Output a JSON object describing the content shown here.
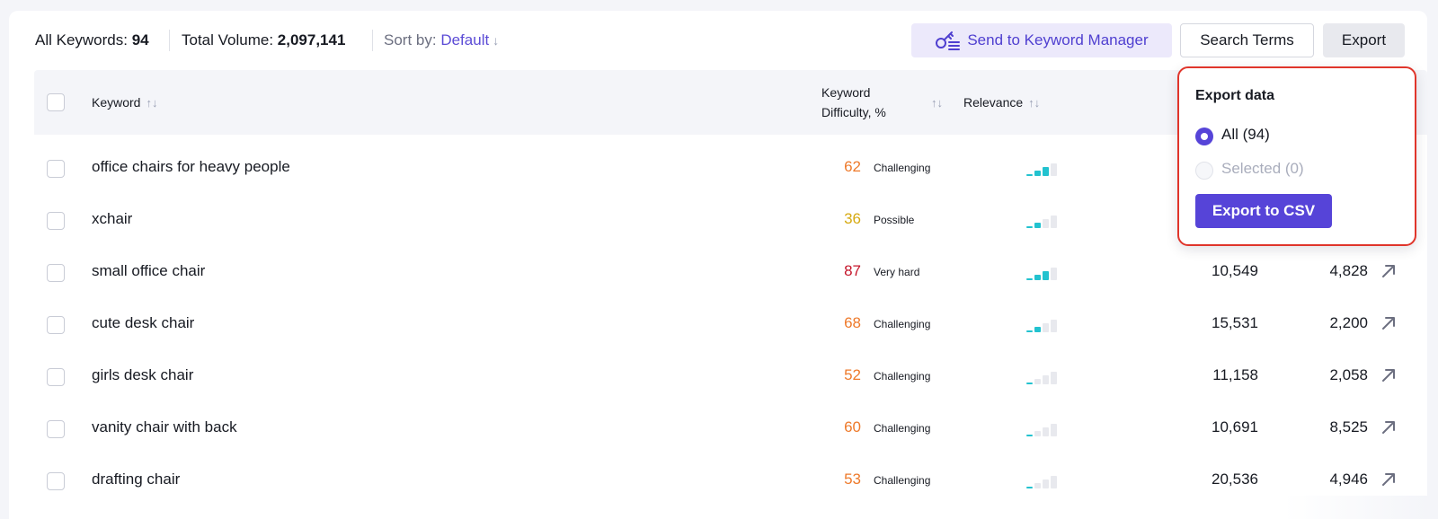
{
  "toolbar": {
    "all_keywords_label": "All Keywords:",
    "all_keywords_value": "94",
    "total_volume_label": "Total Volume:",
    "total_volume_value": "2,097,141",
    "sort_label": "Sort by:",
    "sort_value": "Default",
    "sort_arrow": "↓",
    "send_button": "Send to Keyword Manager",
    "search_terms_button": "Search Terms",
    "export_button": "Export"
  },
  "table": {
    "headers": {
      "keyword": "Keyword",
      "difficulty_line1": "Keyword",
      "difficulty_line2": "Difficulty, %",
      "relevance": "Relevance"
    },
    "sort_icon": "↑↓",
    "rows": [
      {
        "keyword": "office chairs for heavy people",
        "kd": "62",
        "kd_label": "Challenging",
        "kd_color": "#ee7a2b",
        "relevance": 3,
        "volume": "",
        "cpc": ""
      },
      {
        "keyword": "xchair",
        "kd": "36",
        "kd_label": "Possible",
        "kd_color": "#d6aa12",
        "relevance": 2,
        "volume": "",
        "cpc": ""
      },
      {
        "keyword": "small office chair",
        "kd": "87",
        "kd_label": "Very hard",
        "kd_color": "#c5162b",
        "relevance": 3,
        "volume": "10,549",
        "cpc": "4,828"
      },
      {
        "keyword": "cute desk chair",
        "kd": "68",
        "kd_label": "Challenging",
        "kd_color": "#ee7a2b",
        "relevance": 2,
        "volume": "15,531",
        "cpc": "2,200"
      },
      {
        "keyword": "girls desk chair",
        "kd": "52",
        "kd_label": "Challenging",
        "kd_color": "#ee7a2b",
        "relevance": 1,
        "volume": "11,158",
        "cpc": "2,058"
      },
      {
        "keyword": "vanity chair with back",
        "kd": "60",
        "kd_label": "Challenging",
        "kd_color": "#ee7a2b",
        "relevance": 1,
        "volume": "10,691",
        "cpc": "8,525"
      },
      {
        "keyword": "drafting chair",
        "kd": "53",
        "kd_label": "Challenging",
        "kd_color": "#ee7a2b",
        "relevance": 1,
        "volume": "20,536",
        "cpc": "4,946"
      }
    ]
  },
  "export_popup": {
    "title": "Export data",
    "option_all": "All (94)",
    "option_selected": "Selected (0)",
    "selected_option": "all",
    "button": "Export to CSV"
  },
  "colors": {
    "accent": "#5644d8",
    "relevance_on": "#22c2cf",
    "relevance_off": "#e8e9ee",
    "highlight": "#e0352b"
  }
}
